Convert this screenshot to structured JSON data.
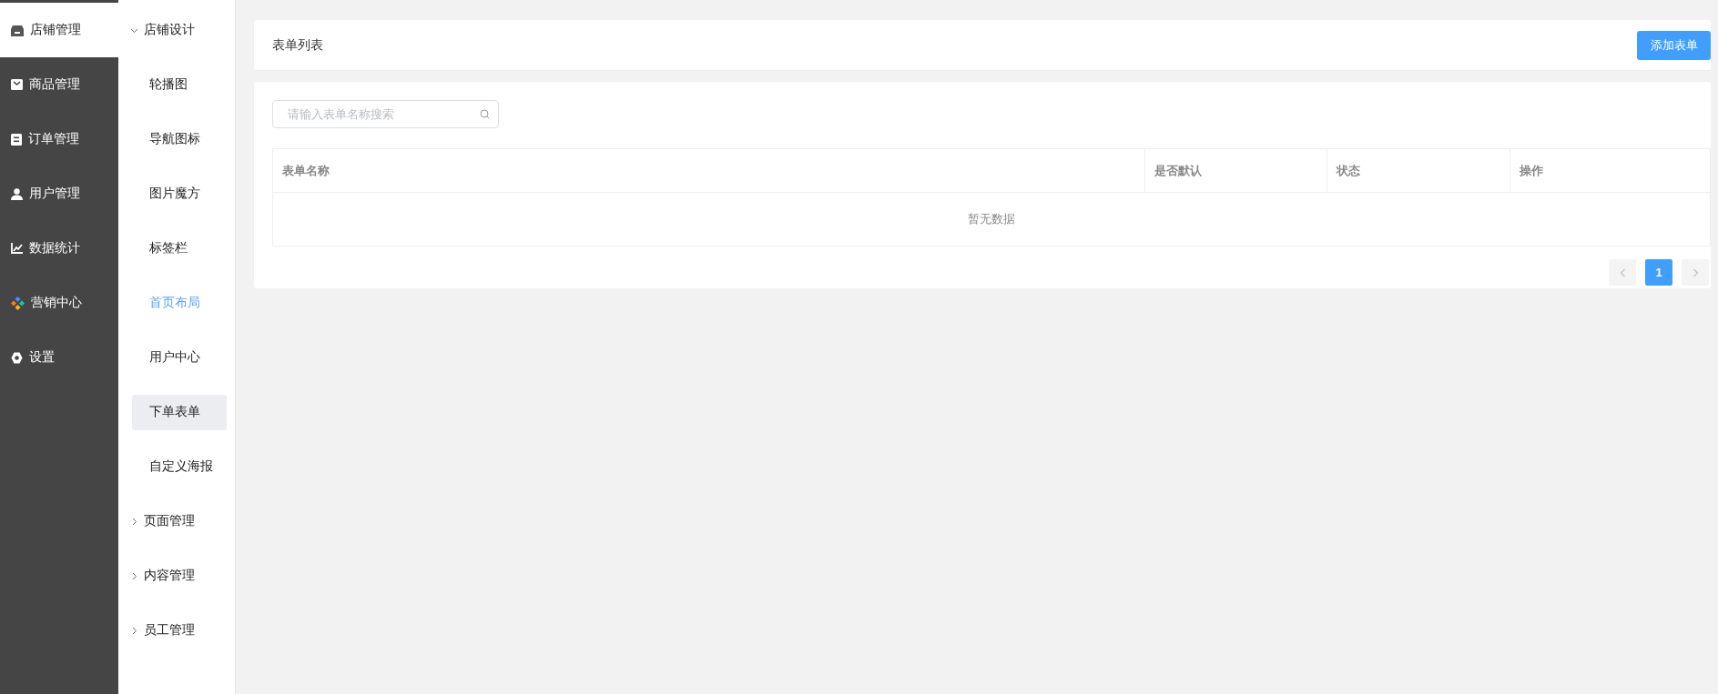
{
  "main_nav": {
    "items": [
      {
        "label": "店铺管理",
        "kind": "store",
        "selected": true
      },
      {
        "label": "商品管理",
        "kind": "products",
        "selected": false
      },
      {
        "label": "订单管理",
        "kind": "orders",
        "selected": false
      },
      {
        "label": "用户管理",
        "kind": "users",
        "selected": false
      },
      {
        "label": "数据统计",
        "kind": "stats",
        "selected": false
      },
      {
        "label": "营销中心",
        "kind": "marketing",
        "selected": false
      },
      {
        "label": "设置",
        "kind": "settings",
        "selected": false
      }
    ]
  },
  "sub_nav": {
    "groups": [
      {
        "label": "店铺设计",
        "expanded": true,
        "children": [
          {
            "label": "轮播图",
            "selected": false,
            "hover": false
          },
          {
            "label": "导航图标",
            "selected": false,
            "hover": false
          },
          {
            "label": "图片魔方",
            "selected": false,
            "hover": false
          },
          {
            "label": "标签栏",
            "selected": false,
            "hover": false
          },
          {
            "label": "首页布局",
            "selected": false,
            "hover": true
          },
          {
            "label": "用户中心",
            "selected": false,
            "hover": false
          },
          {
            "label": "下单表单",
            "selected": true,
            "hover": false
          },
          {
            "label": "自定义海报",
            "selected": false,
            "hover": false
          }
        ]
      },
      {
        "label": "页面管理",
        "expanded": false
      },
      {
        "label": "内容管理",
        "expanded": false
      },
      {
        "label": "员工管理",
        "expanded": false
      }
    ]
  },
  "header": {
    "title": "表单列表",
    "add_button": "添加表单"
  },
  "search": {
    "placeholder": "请输入表单名称搜索"
  },
  "table": {
    "columns": [
      "表单名称",
      "是否默认",
      "状态",
      "操作"
    ],
    "empty_text": "暂无数据"
  },
  "pagination": {
    "pages": [
      {
        "label": "1",
        "selected": true
      }
    ]
  }
}
